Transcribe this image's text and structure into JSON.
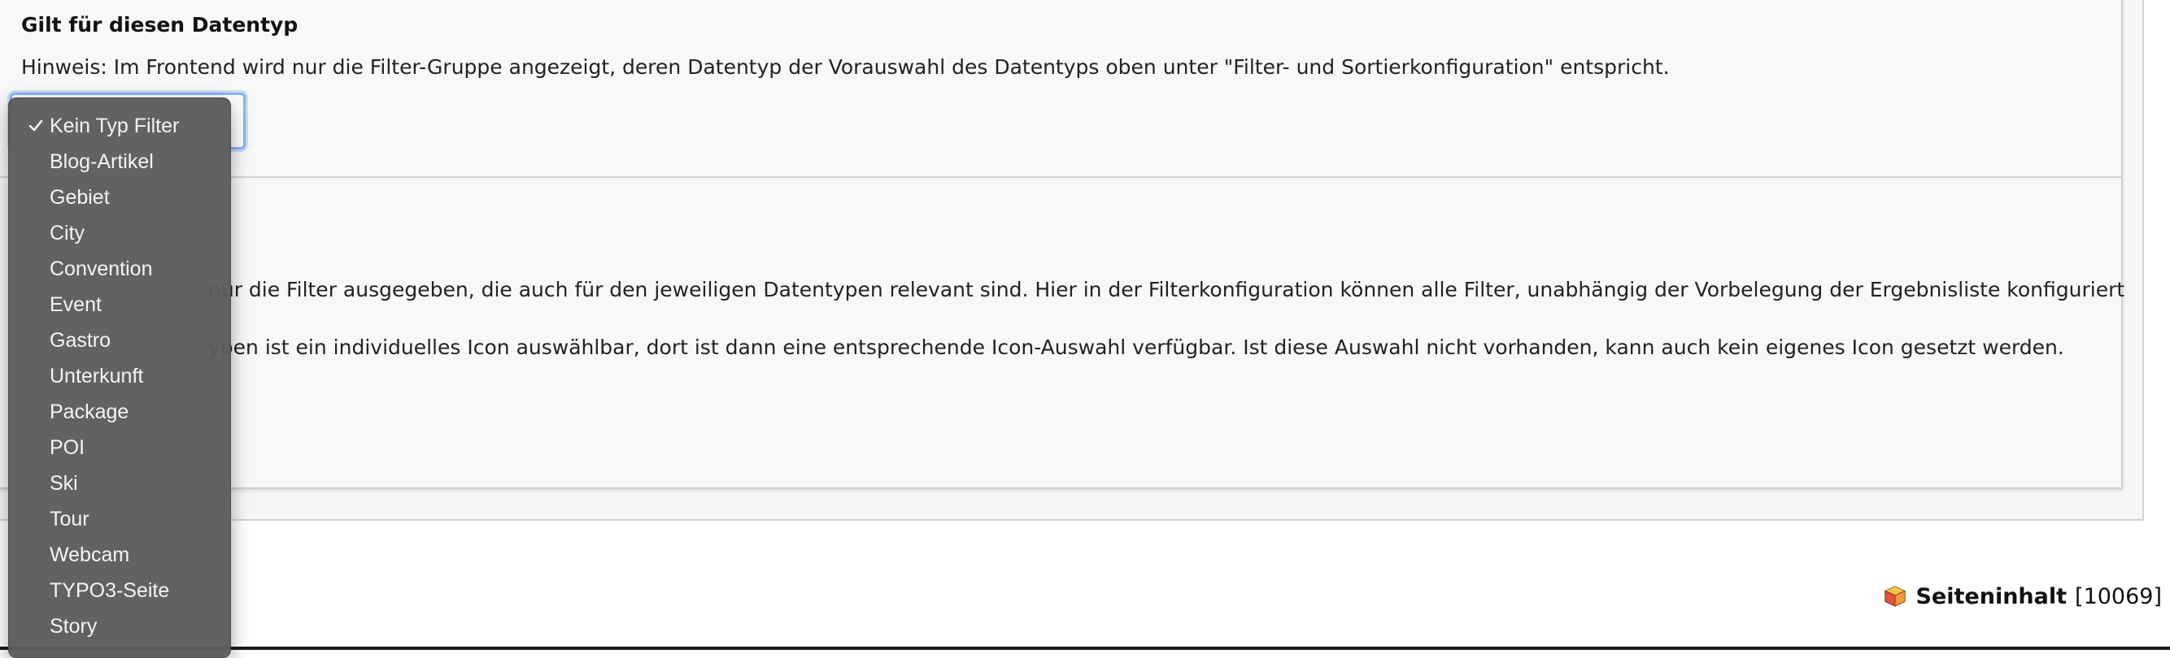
{
  "form": {
    "field_label": "Gilt für diesen Datentyp",
    "hint": "Hinweis: Im Frontend wird nur die Filter-Gruppe angezeigt, deren Datentyp der Vorauswahl des Datentyps oben unter \"Filter- und Sortierkonfiguration\" entspricht.",
    "body_line_1": "nur die Filter ausgegeben, die auch für den jeweiligen Datentypen relevant sind. Hier in der Filterkonfiguration können alle Filter, unabhängig der Vorbelegung der Ergebnisliste konfiguriert",
    "body_line_2": "ypen ist ein individuelles Icon auswählbar, dort ist dann eine entsprechende Icon-Auswahl verfügbar. Ist diese Auswahl nicht vorhanden, kann auch kein eigenes Icon gesetzt werden."
  },
  "dropdown": {
    "selected": "Kein Typ Filter",
    "options": [
      "Kein Typ Filter",
      "Blog-Artikel",
      "Gebiet",
      "City",
      "Convention",
      "Event",
      "Gastro",
      "Unterkunft",
      "Package",
      "POI",
      "Ski",
      "Tour",
      "Webcam",
      "TYPO3-Seite",
      "Story"
    ]
  },
  "footer": {
    "content_title": "Seiteninhalt",
    "content_id": "[10069]",
    "icon": "cube-icon"
  },
  "colors": {
    "dropdown_bg": "#5c5c5c",
    "select_focus": "#8fb3e8",
    "panel_bg": "#f8f8f8"
  }
}
